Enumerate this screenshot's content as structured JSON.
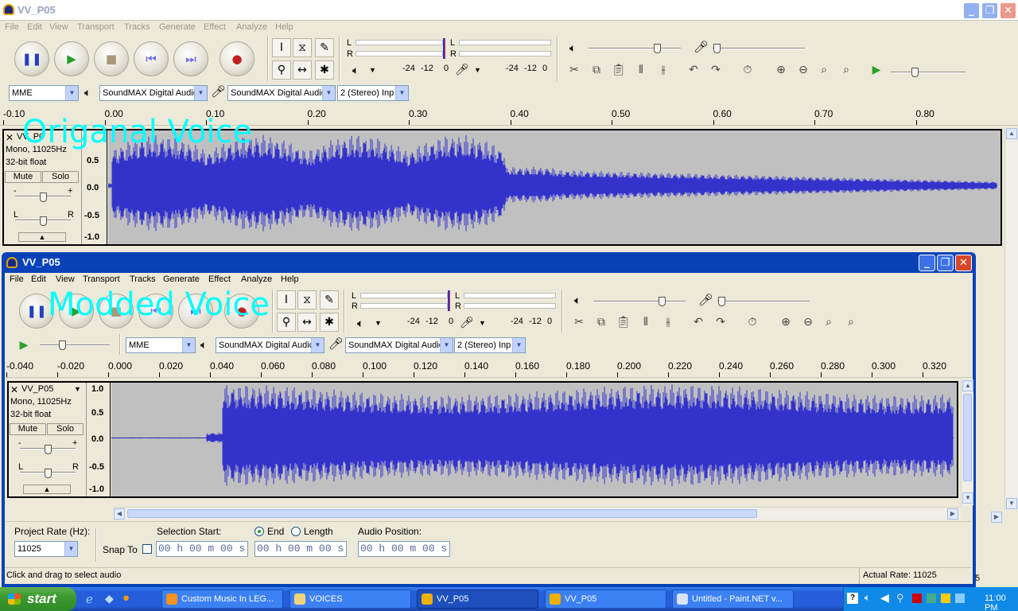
{
  "back_window": {
    "title": "VV_P05",
    "menu": [
      "File",
      "Edit",
      "View",
      "Transport",
      "Tracks",
      "Generate",
      "Effect",
      "Analyze",
      "Help"
    ],
    "host_device": "MME",
    "output_device": "SoundMAX Digital Audio",
    "input_device": "SoundMAX Digital Audio",
    "channels": "2 (Stereo) Inp",
    "meter_labels": [
      "L",
      "R"
    ],
    "meter_ticks": [
      "-24",
      "-12",
      "0"
    ],
    "ruler_ticks": [
      "-0.10",
      "0.00",
      "0.10",
      "0.20",
      "0.30",
      "0.40",
      "0.50",
      "0.60",
      "0.70",
      "0.80"
    ],
    "track": {
      "name": "VV_P0",
      "format": "Mono, 11025Hz",
      "bits": "32-bit float",
      "mute": "Mute",
      "solo": "Solo",
      "gain_labels": [
        "-",
        "+"
      ],
      "pan_labels": [
        "L",
        "R"
      ],
      "y_labels": [
        "0.5",
        "0.0",
        "-0.5",
        "-1.0"
      ]
    },
    "overlay_text": "Origanal Voice",
    "side_digit": "5"
  },
  "front_window": {
    "title": "VV_P05",
    "menu": [
      "File",
      "Edit",
      "View",
      "Transport",
      "Tracks",
      "Generate",
      "Effect",
      "Analyze",
      "Help"
    ],
    "host_device": "MME",
    "output_device": "SoundMAX Digital Audio",
    "input_device": "SoundMAX Digital Audio",
    "channels": "2 (Stereo) Inp",
    "meter_labels": [
      "L",
      "R"
    ],
    "meter_ticks": [
      "-24",
      "-12",
      "0"
    ],
    "ruler_ticks": [
      "-0.040",
      "-0.020",
      "0.000",
      "0.020",
      "0.040",
      "0.060",
      "0.080",
      "0.100",
      "0.120",
      "0.140",
      "0.160",
      "0.180",
      "0.200",
      "0.220",
      "0.240",
      "0.260",
      "0.280",
      "0.300",
      "0.320"
    ],
    "track": {
      "name": "VV_P05",
      "format": "Mono, 11025Hz",
      "bits": "32-bit float",
      "mute": "Mute",
      "solo": "Solo",
      "gain_labels": [
        "-",
        "+"
      ],
      "pan_labels": [
        "L",
        "R"
      ],
      "y_labels": [
        "1.0",
        "0.5",
        "0.0",
        "-0.5",
        "-1.0"
      ]
    },
    "overlay_text": "Modded Voice",
    "project_rate_label": "Project Rate (Hz):",
    "project_rate": "11025",
    "snap_to_label": "Snap To",
    "selection_start_label": "Selection Start:",
    "end_label": "End",
    "length_label": "Length",
    "audio_position_label": "Audio Position:",
    "time_value": "00 h 00 m 00 s",
    "status_left": "Click and drag to select audio",
    "status_right": "Actual Rate: 11025"
  },
  "taskbar": {
    "start": "start",
    "tasks": [
      "Custom Music In LEG...",
      "VOICES",
      "VV_P05",
      "VV_P05",
      "Untitled - Paint.NET v..."
    ],
    "clock": "11:00 PM"
  },
  "colors": {
    "waveform": "#3333cc",
    "wave_bg": "#c0c0c0",
    "overlay": "#00ffff",
    "xp_blue": "#0842b8"
  },
  "icons": [
    "pause-icon",
    "play-icon",
    "stop-icon",
    "skip-start-icon",
    "skip-end-icon",
    "record-icon",
    "selection-tool-icon",
    "envelope-tool-icon",
    "draw-tool-icon",
    "zoom-tool-icon",
    "timeshift-tool-icon",
    "multi-tool-icon",
    "speaker-icon",
    "microphone-icon",
    "cut-icon",
    "copy-icon",
    "paste-icon",
    "trim-icon",
    "silence-icon",
    "undo-icon",
    "redo-icon",
    "sync-lock-icon",
    "zoom-in-icon",
    "zoom-out-icon",
    "fit-selection-icon",
    "fit-project-icon"
  ]
}
